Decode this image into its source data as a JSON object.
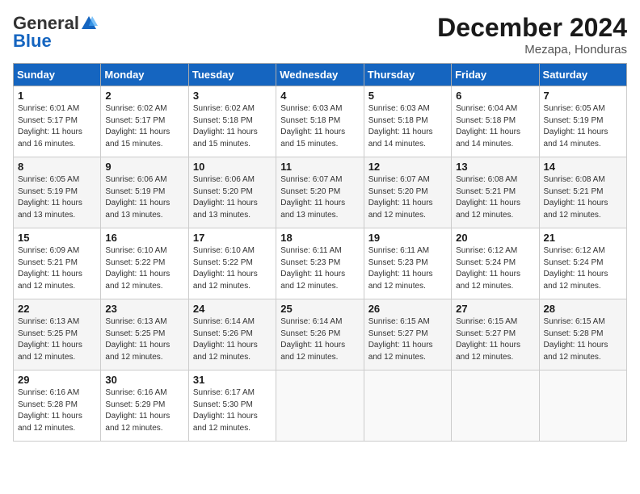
{
  "header": {
    "logo_general": "General",
    "logo_blue": "Blue",
    "title": "December 2024",
    "location": "Mezapa, Honduras"
  },
  "weekdays": [
    "Sunday",
    "Monday",
    "Tuesday",
    "Wednesday",
    "Thursday",
    "Friday",
    "Saturday"
  ],
  "weeks": [
    [
      {
        "day": "1",
        "sunrise": "6:01 AM",
        "sunset": "5:17 PM",
        "daylight": "11 hours and 16 minutes."
      },
      {
        "day": "2",
        "sunrise": "6:02 AM",
        "sunset": "5:17 PM",
        "daylight": "11 hours and 15 minutes."
      },
      {
        "day": "3",
        "sunrise": "6:02 AM",
        "sunset": "5:18 PM",
        "daylight": "11 hours and 15 minutes."
      },
      {
        "day": "4",
        "sunrise": "6:03 AM",
        "sunset": "5:18 PM",
        "daylight": "11 hours and 15 minutes."
      },
      {
        "day": "5",
        "sunrise": "6:03 AM",
        "sunset": "5:18 PM",
        "daylight": "11 hours and 14 minutes."
      },
      {
        "day": "6",
        "sunrise": "6:04 AM",
        "sunset": "5:18 PM",
        "daylight": "11 hours and 14 minutes."
      },
      {
        "day": "7",
        "sunrise": "6:05 AM",
        "sunset": "5:19 PM",
        "daylight": "11 hours and 14 minutes."
      }
    ],
    [
      {
        "day": "8",
        "sunrise": "6:05 AM",
        "sunset": "5:19 PM",
        "daylight": "11 hours and 13 minutes."
      },
      {
        "day": "9",
        "sunrise": "6:06 AM",
        "sunset": "5:19 PM",
        "daylight": "11 hours and 13 minutes."
      },
      {
        "day": "10",
        "sunrise": "6:06 AM",
        "sunset": "5:20 PM",
        "daylight": "11 hours and 13 minutes."
      },
      {
        "day": "11",
        "sunrise": "6:07 AM",
        "sunset": "5:20 PM",
        "daylight": "11 hours and 13 minutes."
      },
      {
        "day": "12",
        "sunrise": "6:07 AM",
        "sunset": "5:20 PM",
        "daylight": "11 hours and 12 minutes."
      },
      {
        "day": "13",
        "sunrise": "6:08 AM",
        "sunset": "5:21 PM",
        "daylight": "11 hours and 12 minutes."
      },
      {
        "day": "14",
        "sunrise": "6:08 AM",
        "sunset": "5:21 PM",
        "daylight": "11 hours and 12 minutes."
      }
    ],
    [
      {
        "day": "15",
        "sunrise": "6:09 AM",
        "sunset": "5:21 PM",
        "daylight": "11 hours and 12 minutes."
      },
      {
        "day": "16",
        "sunrise": "6:10 AM",
        "sunset": "5:22 PM",
        "daylight": "11 hours and 12 minutes."
      },
      {
        "day": "17",
        "sunrise": "6:10 AM",
        "sunset": "5:22 PM",
        "daylight": "11 hours and 12 minutes."
      },
      {
        "day": "18",
        "sunrise": "6:11 AM",
        "sunset": "5:23 PM",
        "daylight": "11 hours and 12 minutes."
      },
      {
        "day": "19",
        "sunrise": "6:11 AM",
        "sunset": "5:23 PM",
        "daylight": "11 hours and 12 minutes."
      },
      {
        "day": "20",
        "sunrise": "6:12 AM",
        "sunset": "5:24 PM",
        "daylight": "11 hours and 12 minutes."
      },
      {
        "day": "21",
        "sunrise": "6:12 AM",
        "sunset": "5:24 PM",
        "daylight": "11 hours and 12 minutes."
      }
    ],
    [
      {
        "day": "22",
        "sunrise": "6:13 AM",
        "sunset": "5:25 PM",
        "daylight": "11 hours and 12 minutes."
      },
      {
        "day": "23",
        "sunrise": "6:13 AM",
        "sunset": "5:25 PM",
        "daylight": "11 hours and 12 minutes."
      },
      {
        "day": "24",
        "sunrise": "6:14 AM",
        "sunset": "5:26 PM",
        "daylight": "11 hours and 12 minutes."
      },
      {
        "day": "25",
        "sunrise": "6:14 AM",
        "sunset": "5:26 PM",
        "daylight": "11 hours and 12 minutes."
      },
      {
        "day": "26",
        "sunrise": "6:15 AM",
        "sunset": "5:27 PM",
        "daylight": "11 hours and 12 minutes."
      },
      {
        "day": "27",
        "sunrise": "6:15 AM",
        "sunset": "5:27 PM",
        "daylight": "11 hours and 12 minutes."
      },
      {
        "day": "28",
        "sunrise": "6:15 AM",
        "sunset": "5:28 PM",
        "daylight": "11 hours and 12 minutes."
      }
    ],
    [
      {
        "day": "29",
        "sunrise": "6:16 AM",
        "sunset": "5:28 PM",
        "daylight": "11 hours and 12 minutes."
      },
      {
        "day": "30",
        "sunrise": "6:16 AM",
        "sunset": "5:29 PM",
        "daylight": "11 hours and 12 minutes."
      },
      {
        "day": "31",
        "sunrise": "6:17 AM",
        "sunset": "5:30 PM",
        "daylight": "11 hours and 12 minutes."
      },
      null,
      null,
      null,
      null
    ]
  ]
}
